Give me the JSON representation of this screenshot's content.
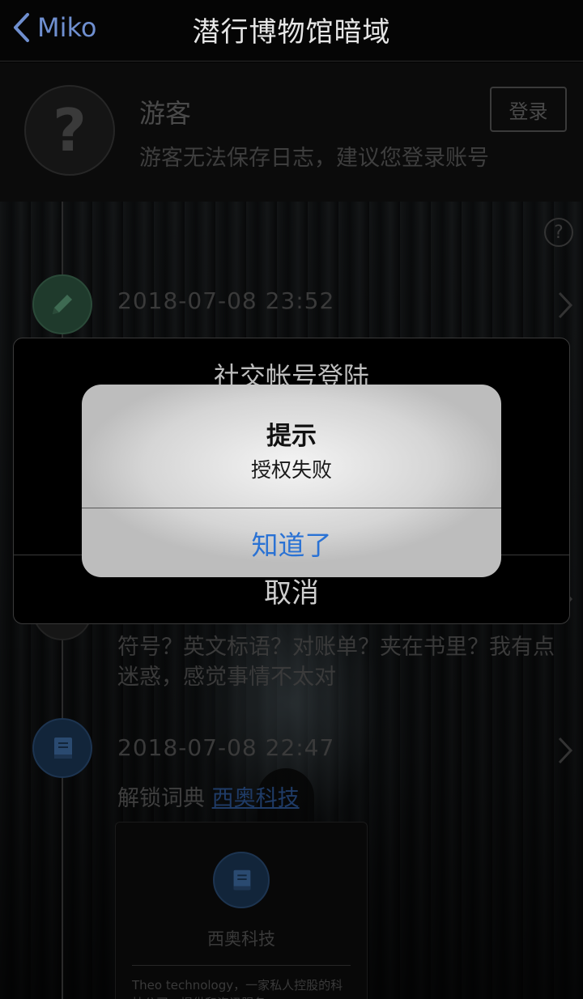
{
  "nav": {
    "back_label": "Miko",
    "title": "潜行博物馆暗域"
  },
  "user": {
    "avatar_glyph": "?",
    "name": "游客",
    "hint": "游客无法保存日志，建议您登录账号",
    "login_label": "登录"
  },
  "timeline": {
    "help_glyph": "?",
    "entries": [
      {
        "icon": "pencil-icon",
        "date": "2018-07-08 23:52"
      },
      {
        "icon": "book-icon",
        "date": "2018-07-08 22:47"
      }
    ],
    "note_text": "符号？英文标语？对账单？夹在书里？我有点迷惑，感觉事情不太对",
    "unlock_prefix": "解锁词典",
    "unlock_link": "西奥科技",
    "card": {
      "title": "西奥科技",
      "description": "Theo technology，一家私人控股的科技公司，提供和资讯服务"
    }
  },
  "sheet": {
    "title": "社交帐号登陆",
    "cancel_label": "取消"
  },
  "alert": {
    "title": "提示",
    "message": "授权失败",
    "button_label": "知道了"
  },
  "colors": {
    "accent_blue": "#2a72d4",
    "nav_back": "#6f8fd0"
  }
}
